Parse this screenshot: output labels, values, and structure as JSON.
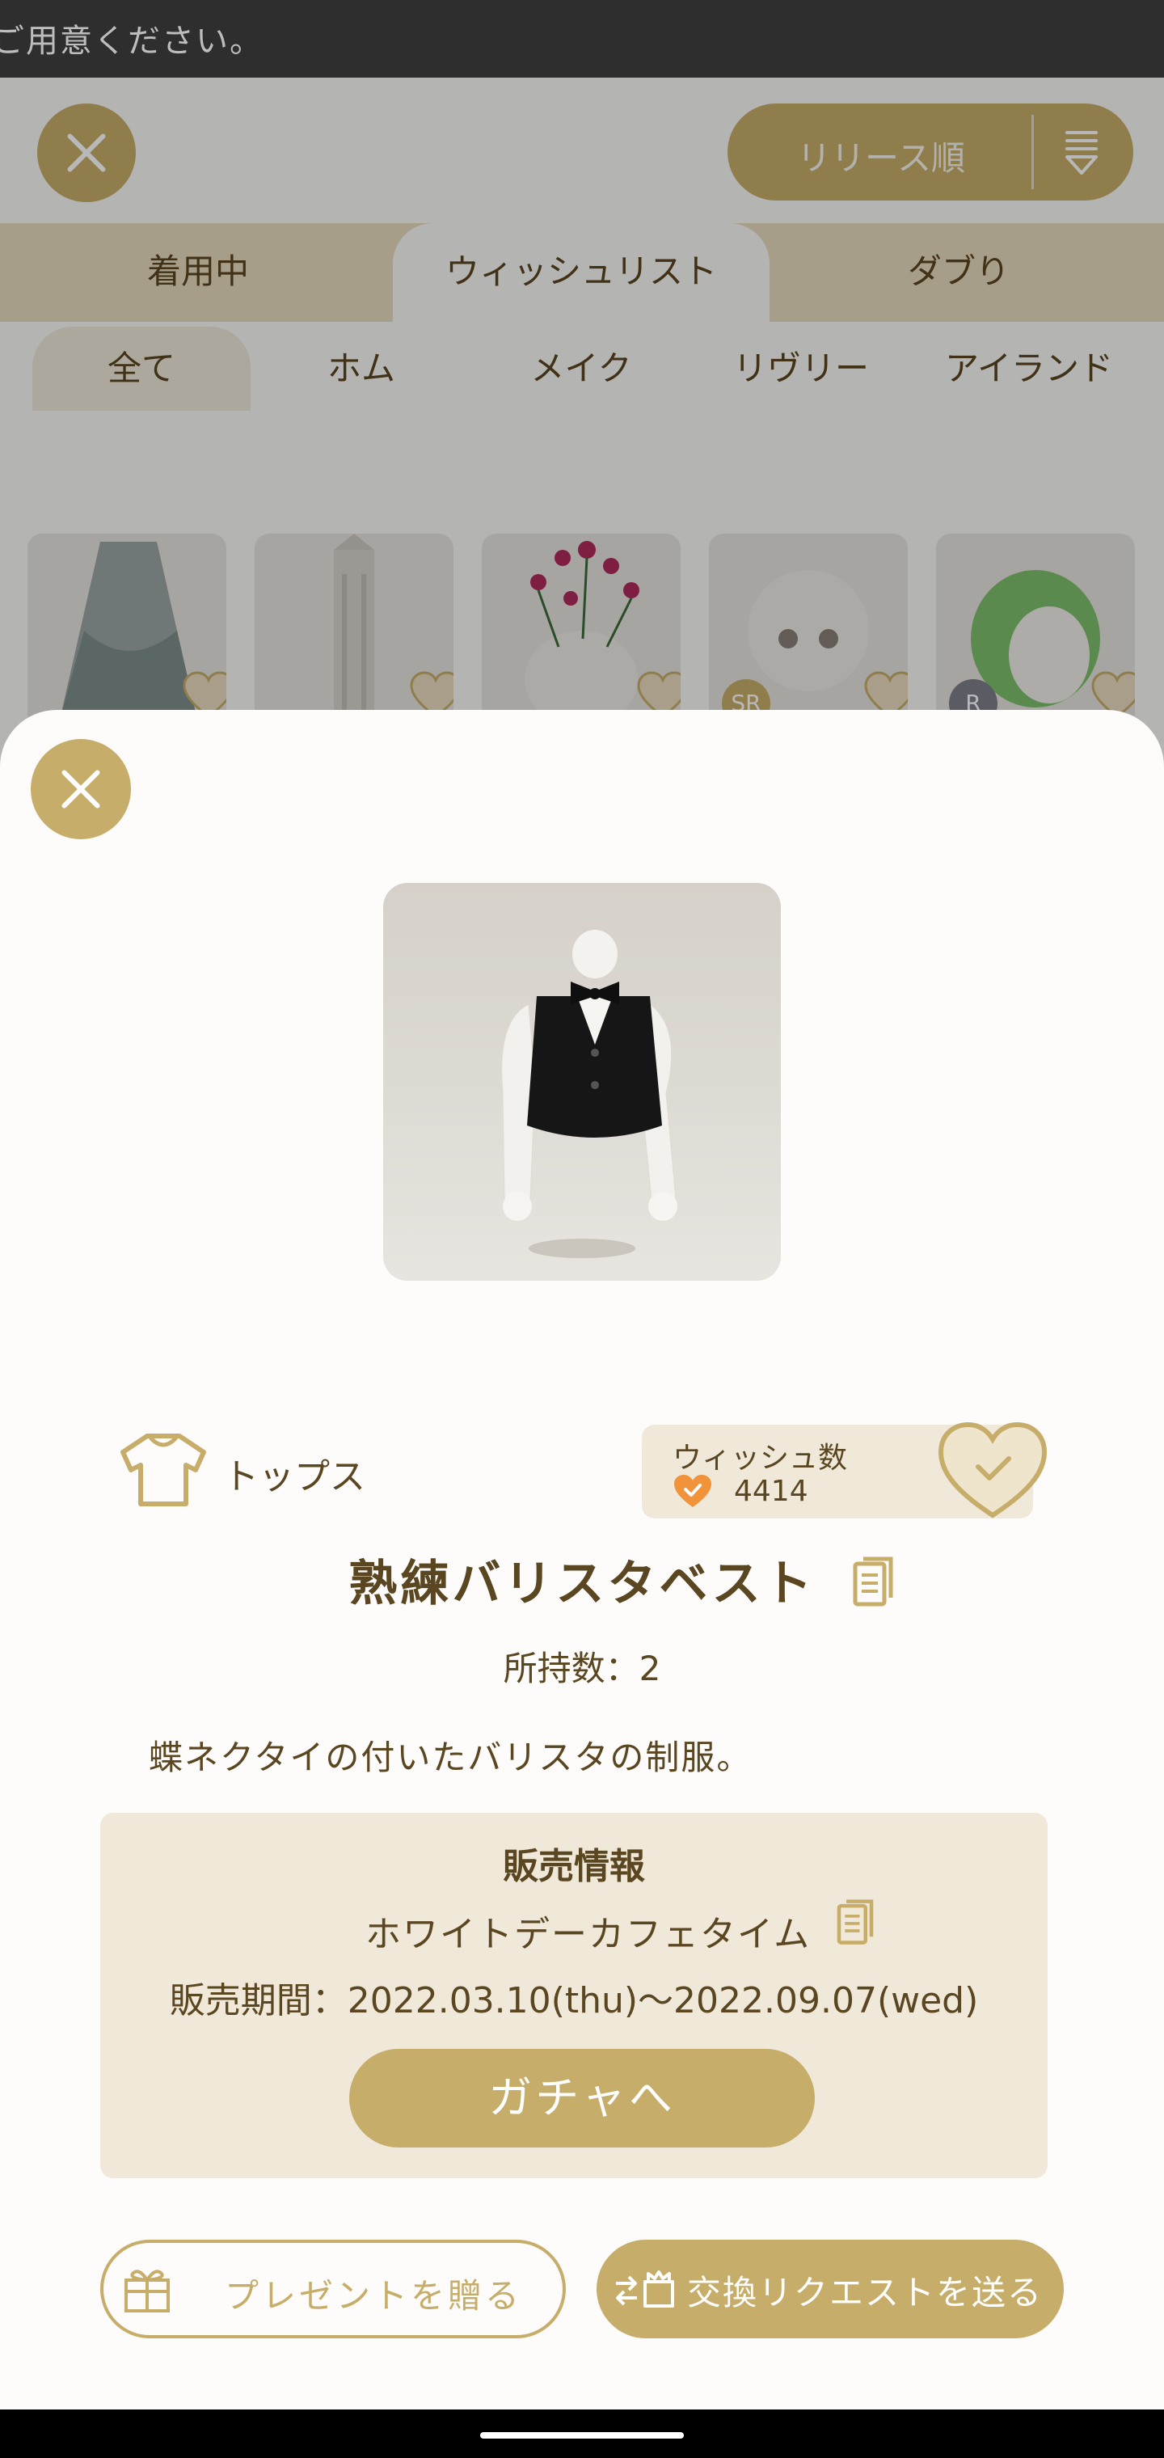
{
  "status_text": "ご用意ください。",
  "header": {
    "sort_label": "リリース順"
  },
  "tabs": [
    {
      "label": "着用中",
      "active": false
    },
    {
      "label": "ウィッシュリスト",
      "active": true
    },
    {
      "label": "ダブり",
      "active": false
    }
  ],
  "subtabs": [
    {
      "label": "全て",
      "active": true
    },
    {
      "label": "ホム",
      "active": false
    },
    {
      "label": "メイク",
      "active": false
    },
    {
      "label": "リヴリー",
      "active": false
    },
    {
      "label": "アイランド",
      "active": false
    }
  ],
  "thumbnails": [
    {
      "rarity": ""
    },
    {
      "rarity": ""
    },
    {
      "rarity": ""
    },
    {
      "rarity": "SR"
    },
    {
      "rarity": "R"
    }
  ],
  "item": {
    "category": "トップス",
    "wish_label": "ウィッシュ数",
    "wish_count": "4414",
    "name": "熟練バリスタベスト",
    "owned": "所持数：2",
    "description": "蝶ネクタイの付いたバリスタの制服。"
  },
  "sales": {
    "title": "販売情報",
    "name": "ホワイトデーカフェタイム",
    "period": "販売期間：2022.03.10(thu)〜2022.09.07(wed)",
    "gacha_button": "ガチャへ"
  },
  "actions": {
    "present_label": "プレゼントを贈る",
    "exchange_label": "交換リクエストを送る"
  },
  "colors": {
    "accent": "#c7ad6a",
    "text": "#5a4620",
    "panel": "#f0e9da",
    "wish_heart": "#f0933a"
  }
}
